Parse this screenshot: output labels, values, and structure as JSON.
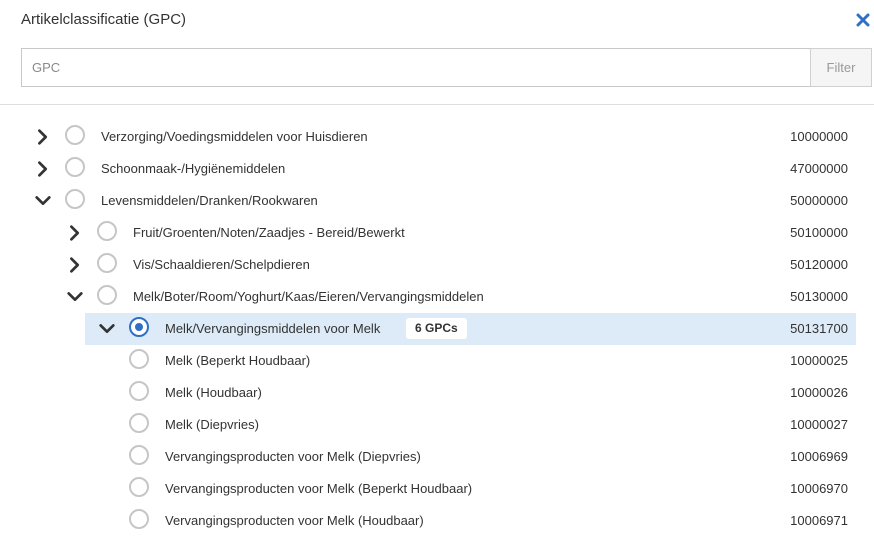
{
  "dialog": {
    "title": "Artikelclassificatie (GPC)",
    "close_icon": "close-icon",
    "accent_color": "#2f6fc6",
    "highlight_color": "#dcebf7"
  },
  "search": {
    "placeholder": "GPC",
    "value": "",
    "filter_label": "Filter"
  },
  "tree": {
    "rows": [
      {
        "level": 0,
        "expander": "collapsed",
        "label": "Verzorging/Voedingsmiddelen voor Huisdieren",
        "code": "10000000",
        "selected": false
      },
      {
        "level": 0,
        "expander": "collapsed",
        "label": "Schoonmaak-/Hygiënemiddelen",
        "code": "47000000",
        "selected": false
      },
      {
        "level": 0,
        "expander": "expanded",
        "label": "Levensmiddelen/Dranken/Rookwaren",
        "code": "50000000",
        "selected": false
      },
      {
        "level": 1,
        "expander": "collapsed",
        "label": "Fruit/Groenten/Noten/Zaadjes - Bereid/Bewerkt",
        "code": "50100000",
        "selected": false
      },
      {
        "level": 1,
        "expander": "collapsed",
        "label": "Vis/Schaaldieren/Schelpdieren",
        "code": "50120000",
        "selected": false
      },
      {
        "level": 1,
        "expander": "expanded",
        "label": "Melk/Boter/Room/Yoghurt/Kaas/Eieren/Vervangingsmiddelen",
        "code": "50130000",
        "selected": false
      },
      {
        "level": 2,
        "expander": "expanded",
        "label": "Melk/Vervangingsmiddelen voor Melk",
        "code": "50131700",
        "selected": true,
        "badge": "6 GPCs"
      },
      {
        "level": 3,
        "expander": "none",
        "label": "Melk (Beperkt Houdbaar)",
        "code": "10000025",
        "selected": false
      },
      {
        "level": 3,
        "expander": "none",
        "label": "Melk (Houdbaar)",
        "code": "10000026",
        "selected": false
      },
      {
        "level": 3,
        "expander": "none",
        "label": "Melk (Diepvries)",
        "code": "10000027",
        "selected": false
      },
      {
        "level": 3,
        "expander": "none",
        "label": "Vervangingsproducten voor Melk (Diepvries)",
        "code": "10006969",
        "selected": false
      },
      {
        "level": 3,
        "expander": "none",
        "label": "Vervangingsproducten voor Melk (Beperkt Houdbaar)",
        "code": "10006970",
        "selected": false
      },
      {
        "level": 3,
        "expander": "none",
        "label": "Vervangingsproducten voor Melk (Houdbaar)",
        "code": "10006971",
        "selected": false
      }
    ]
  }
}
